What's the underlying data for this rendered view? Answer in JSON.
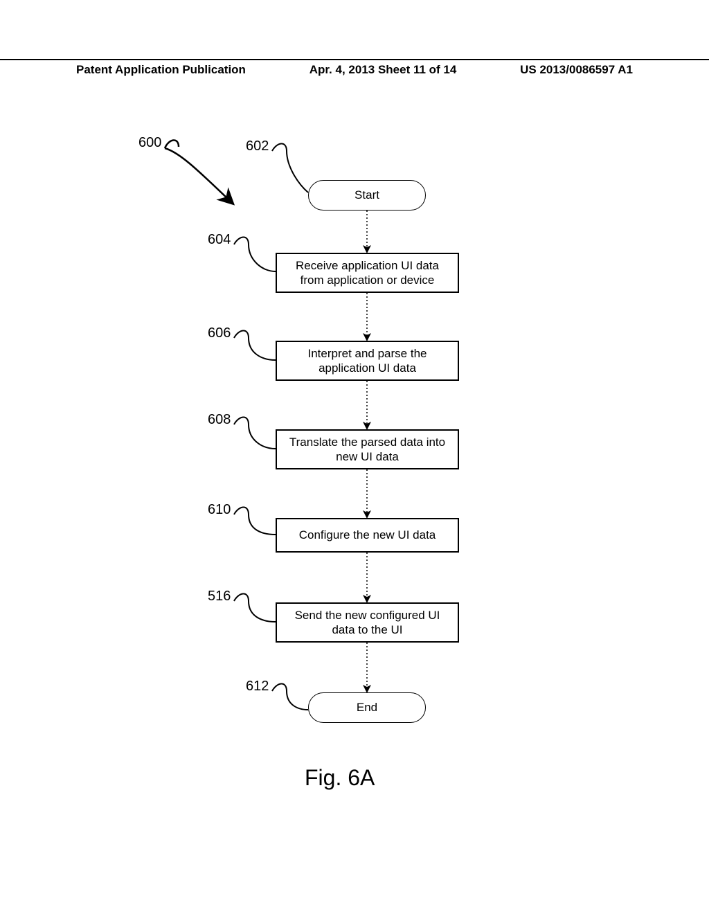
{
  "header": {
    "left": "Patent Application Publication",
    "mid": "Apr. 4, 2013  Sheet 11 of 14",
    "right": "US 2013/0086597 A1"
  },
  "refs": {
    "r600": "600",
    "r602": "602",
    "r604": "604",
    "r606": "606",
    "r608": "608",
    "r610": "610",
    "r516": "516",
    "r612": "612"
  },
  "steps": {
    "start": "Start",
    "s604": "Receive application UI data from application or device",
    "s606": "Interpret and parse the application UI data",
    "s608": "Translate the parsed data into new UI data",
    "s610": "Configure the new UI data",
    "s516": "Send the new configured UI data to the UI",
    "end": "End"
  },
  "caption": "Fig. 6A",
  "chart_data": {
    "type": "flowchart",
    "title": "Fig. 6A",
    "nodes": [
      {
        "id": "600",
        "ref": "600",
        "type": "pointer",
        "label": ""
      },
      {
        "id": "602",
        "ref": "602",
        "type": "terminator",
        "label": "Start"
      },
      {
        "id": "604",
        "ref": "604",
        "type": "process",
        "label": "Receive application UI data from application or device"
      },
      {
        "id": "606",
        "ref": "606",
        "type": "process",
        "label": "Interpret and parse the application UI data"
      },
      {
        "id": "608",
        "ref": "608",
        "type": "process",
        "label": "Translate the parsed data into new UI data"
      },
      {
        "id": "610",
        "ref": "610",
        "type": "process",
        "label": "Configure the new UI data"
      },
      {
        "id": "516",
        "ref": "516",
        "type": "process",
        "label": "Send the new configured UI data to the UI"
      },
      {
        "id": "612",
        "ref": "612",
        "type": "terminator",
        "label": "End"
      }
    ],
    "edges": [
      {
        "from": "602",
        "to": "604"
      },
      {
        "from": "604",
        "to": "606"
      },
      {
        "from": "606",
        "to": "608"
      },
      {
        "from": "608",
        "to": "610"
      },
      {
        "from": "610",
        "to": "516"
      },
      {
        "from": "516",
        "to": "612"
      }
    ]
  }
}
